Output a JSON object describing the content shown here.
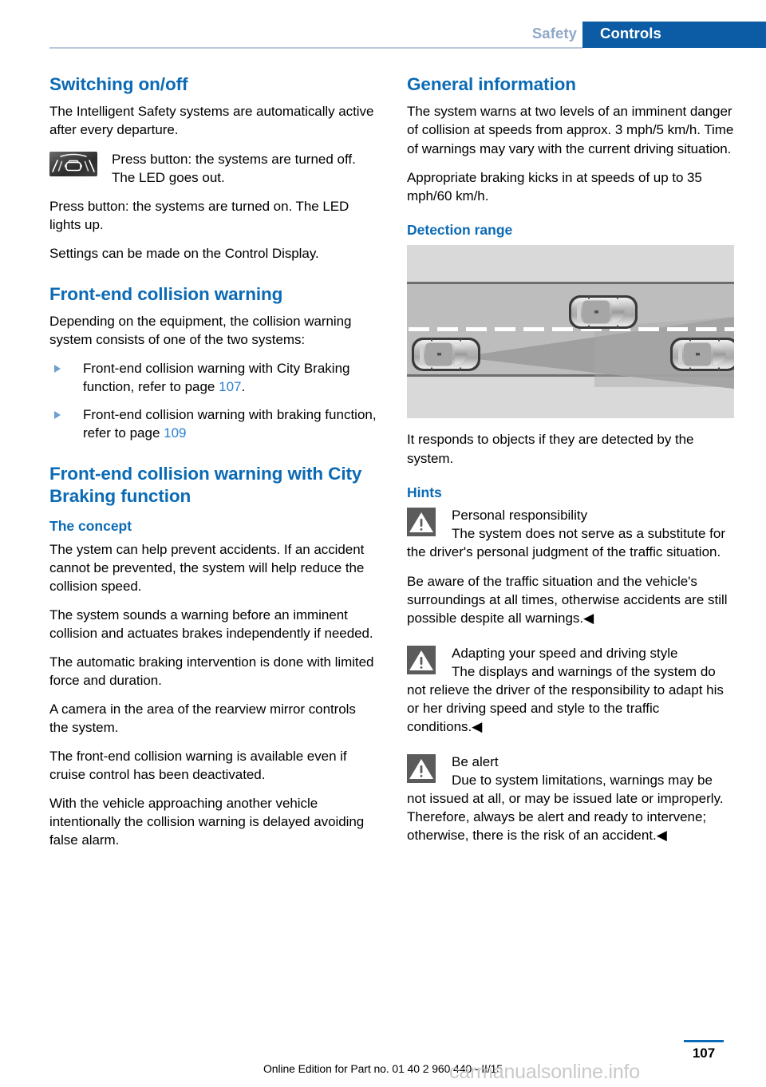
{
  "header": {
    "chapter": "Safety",
    "section": "Controls"
  },
  "left_column": {
    "switching": {
      "heading": "Switching on/off",
      "intro": "The Intelligent Safety systems are automatically active after every departure.",
      "button_note": {
        "icon": "intelligent-safety-button-icon",
        "text": "Press button: the systems are turned off. The LED goes out."
      },
      "para_on": "Press button: the systems are turned on. The LED lights up.",
      "para_settings": "Settings can be made on the Control Display."
    },
    "collision_warning": {
      "heading": "Front-end collision warning",
      "intro": "Depending on the equipment, the collision warning system consists of one of the two systems:",
      "bullets": [
        {
          "text_before": "Front-end collision warning with City Braking function, refer to page ",
          "page_link": "107",
          "text_after": "."
        },
        {
          "text_before": "Front-end collision warning with braking function, refer to page ",
          "page_link": "109",
          "text_after": ""
        }
      ]
    },
    "city_braking": {
      "heading": "Front-end collision warning with City Braking function",
      "subheading": "The concept",
      "paragraphs": [
        "The ystem can help prevent accidents. If an accident cannot be prevented, the system will help reduce the collision speed.",
        "The system sounds a warning before an imminent collision and actuates brakes independently if needed.",
        "The automatic braking intervention is done with limited force and duration.",
        "A camera in the area of the rearview mirror controls the system.",
        "The front-end collision warning is available even if cruise control has been deactivated.",
        "With the vehicle approaching another vehicle intentionally the collision warning is delayed avoiding false alarm."
      ]
    }
  },
  "right_column": {
    "general_information": {
      "heading": "General information",
      "paragraphs": [
        "The system warns at two levels of an imminent danger of collision at speeds from approx. 3 mph/5 km/h. Time of warnings may vary with the current driving situation.",
        "Appropriate braking kicks in at speeds of up to 35 mph/60 km/h."
      ]
    },
    "detection_range": {
      "heading": "Detection range",
      "figure_alt": "top-down-road-detection-cone-illustration",
      "caption": "It responds to objects if they are detected by the system."
    },
    "hints": {
      "heading": "Hints",
      "notes": [
        {
          "icon": "warning-triangle-icon",
          "title": "Personal responsibility",
          "body_first": "The system does not serve as a substitute for the driver's personal judgment of the traffic situation.",
          "body_rest": "Be aware of the traffic situation and the vehicle's surroundings at all times, otherwise accidents are still possible despite all warnings.◀"
        },
        {
          "icon": "warning-triangle-icon",
          "title": "Adapting your speed and driving style",
          "body_first": "The displays and warnings of the system do not relieve the driver of the responsibility to adapt his or her driving speed and style to the traffic conditions.◀",
          "body_rest": ""
        },
        {
          "icon": "warning-triangle-icon",
          "title": "Be alert",
          "body_first": "Due to system limitations, warnings may be not issued at all, or may be issued late or improperly. Therefore, always be alert and ready to intervene; otherwise, there is the risk of an accident.◀",
          "body_rest": ""
        }
      ]
    }
  },
  "footer": {
    "page_number": "107",
    "edition_text": "Online Edition for Part no. 01 40 2 960 440 - II/15",
    "watermark": "carmanualsonline.info"
  },
  "colors": {
    "accent_blue": "#0b6ab5",
    "header_band": "#0b5ca5",
    "link_blue": "#2a7fd4",
    "chapter_gray_blue": "#8fa8c8",
    "note_icon_gray": "#5b5b5b"
  }
}
